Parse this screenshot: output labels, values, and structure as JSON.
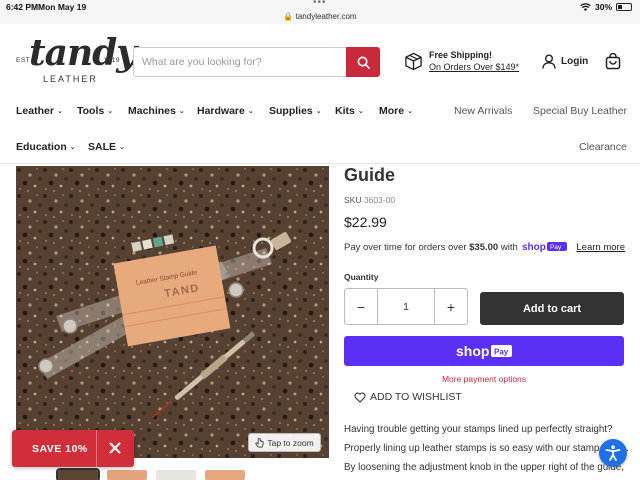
{
  "status_bar": {
    "time": "6:42 PM",
    "date": "Mon May 19",
    "url": "tandyleather.com",
    "battery": "30%"
  },
  "header": {
    "logo": {
      "est": "EST",
      "year": "1919",
      "word": "tandy",
      "sub": "LEATHER"
    },
    "search_placeholder": "What are you looking for?",
    "shipping_title": "Free Shipping!",
    "shipping_sub": "On Orders Over $149*",
    "login": "Login"
  },
  "nav": {
    "row1": [
      "Leather",
      "Tools",
      "Machines",
      "Hardware",
      "Supplies",
      "Kits",
      "More"
    ],
    "row1_links": [
      "New Arrivals",
      "Special Buy Leather"
    ],
    "row2": [
      "Education",
      "SALE"
    ],
    "row2_links": [
      "Clearance"
    ]
  },
  "product": {
    "title_fragment": "Guide",
    "sku_label": "SKU",
    "sku": "3603-00",
    "price": "$22.99",
    "pay_over_prefix": "Pay over time for orders over",
    "pay_over_amount": "$35.00",
    "pay_over_with": "with",
    "learn_more": "Learn more",
    "quantity_label": "Quantity",
    "quantity": "1",
    "add_to_cart": "Add to cart",
    "more_payment": "More payment options",
    "wishlist": "ADD TO WISHLIST",
    "tap_to_zoom": "Tap to zoom",
    "image_texts": {
      "stamp_guide": "Leather Stamp Guide",
      "tandy_stamp": "TAND"
    },
    "description": "Having trouble getting your stamps lined up perfectly straight? Properly lining up leather stamps is so easy with our stamp guide. By loosening the adjustment knob in the upper right of the guide, you can adjust the guide to fit any of our alphabet"
  },
  "promo": {
    "label": "SAVE 10%"
  },
  "colors": {
    "brand_red": "#c8293b",
    "shop_pay": "#5a31f4",
    "cart_button": "#333333",
    "accessibility": "#1f6fe5"
  }
}
